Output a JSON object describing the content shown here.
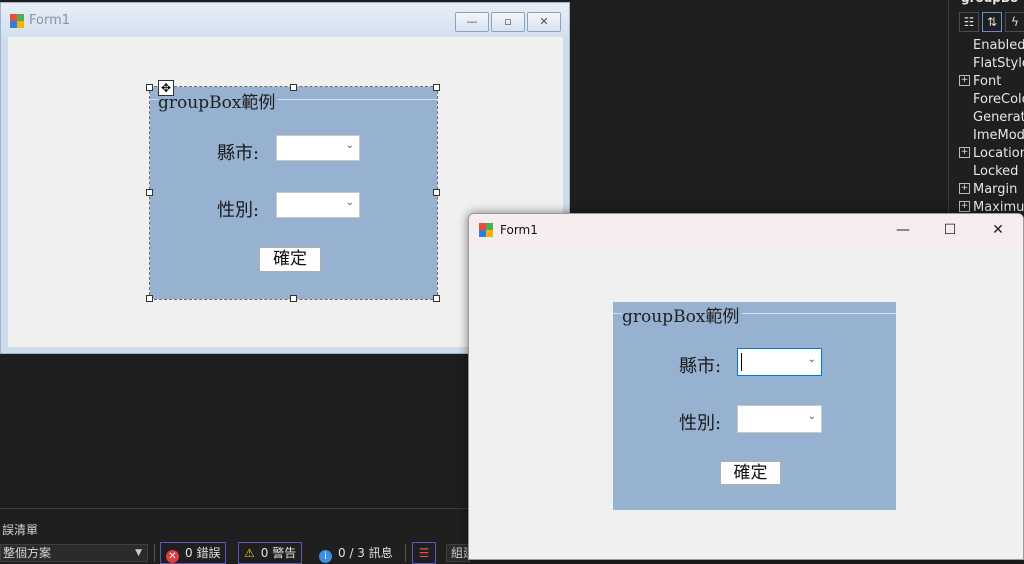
{
  "designer": {
    "title": "Form1",
    "caption_buttons": {
      "minimize": "—",
      "restore": "▫",
      "close": "✕"
    },
    "groupbox": {
      "caption": "groupBox範例",
      "city_label": "縣市:",
      "gender_label": "性別:",
      "city_value": "",
      "gender_value": "",
      "ok_button": "確定"
    }
  },
  "running": {
    "title": "Form1",
    "caption_buttons": {
      "minimize": "—",
      "maximize": "☐",
      "close": "✕"
    },
    "groupbox": {
      "caption": "groupBox範例",
      "city_label": "縣市:",
      "gender_label": "性別:",
      "city_value": "",
      "gender_value": "",
      "ok_button": "確定"
    }
  },
  "properties": {
    "header": "groupBo",
    "items": [
      {
        "name": "Enabled",
        "expandable": false
      },
      {
        "name": "FlatStyle",
        "expandable": false
      },
      {
        "name": "Font",
        "expandable": true
      },
      {
        "name": "ForeColo",
        "expandable": false
      },
      {
        "name": "Generate",
        "expandable": false
      },
      {
        "name": "ImeMode",
        "expandable": false
      },
      {
        "name": "Location",
        "expandable": true
      },
      {
        "name": "Locked",
        "expandable": false
      },
      {
        "name": "Margin",
        "expandable": true
      },
      {
        "name": "Maximum",
        "expandable": true
      }
    ]
  },
  "error_list": {
    "title": "誤清單",
    "scope": "整個方案",
    "errors": "0 錯誤",
    "warnings": "0 警告",
    "messages": "0 / 3 訊息",
    "build_label": "組建"
  },
  "colors": {
    "groupbox_bg": "#97b1d0",
    "focus_border": "#0078d7",
    "ide_bg": "#1e1e1e"
  }
}
